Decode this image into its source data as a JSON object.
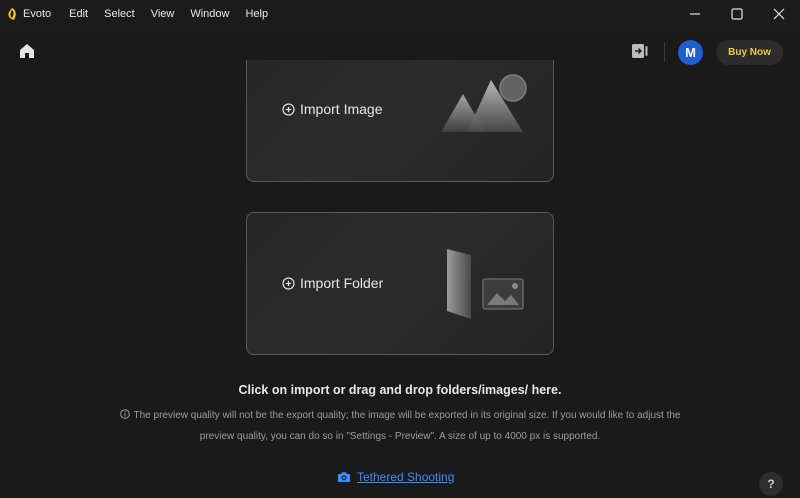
{
  "app": {
    "name": "Evoto",
    "menu": [
      "Edit",
      "Select",
      "View",
      "Window",
      "Help"
    ]
  },
  "toolbar": {
    "avatar_initial": "M",
    "buy_label": "Buy Now"
  },
  "cards": {
    "import_image_label": "Import Image",
    "import_folder_label": "Import Folder"
  },
  "hint": "Click on import or drag and drop folders/images/ here.",
  "notice": {
    "line1": "The preview quality will not be the export quality; the image will be exported in its original size. If you would like to adjust the",
    "line2": "preview quality, you can do so in \"Settings - Preview\". A size of up to 4000 px is supported."
  },
  "tethered_label": "Tethered Shooting",
  "help_label": "?",
  "colors": {
    "background": "#1a1a1a",
    "accent_blue": "#3d8bfd",
    "avatar_blue": "#1f5fd1",
    "buy_text": "#f0c64a"
  },
  "icons": {
    "home": "home-icon",
    "export": "export-icon",
    "plus_circle": "plus-circle-icon",
    "camera": "camera-icon",
    "info": "info-icon",
    "minimize": "minimize-icon",
    "maximize": "maximize-icon",
    "close": "close-icon"
  }
}
